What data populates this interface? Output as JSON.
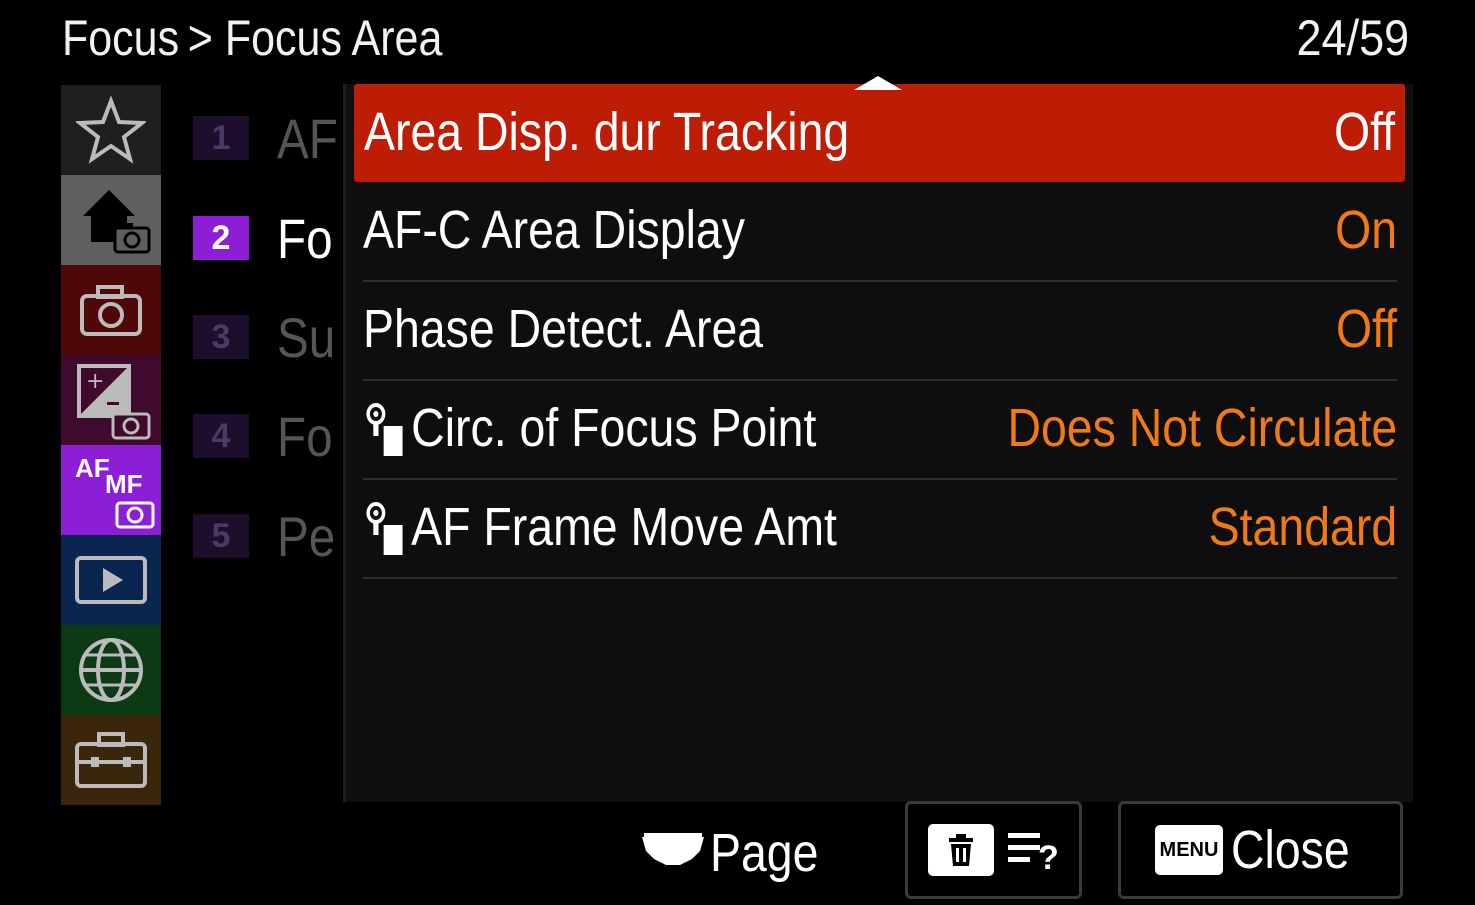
{
  "header": {
    "crumb_parent": "Focus",
    "crumb_separator": ">",
    "crumb_current": "Focus Area",
    "page_counter": "24/59"
  },
  "rail": {
    "items": [
      {
        "name": "my-menu",
        "icon": "star-icon",
        "color": "#1f1f1f"
      },
      {
        "name": "main-photo",
        "icon": "home-camera-icon",
        "color": "#5f5f5f"
      },
      {
        "name": "shooting",
        "icon": "camera-icon",
        "color": "#4f0808"
      },
      {
        "name": "exposure-color",
        "icon": "exposure-camera-icon",
        "color": "#3f0a2c"
      },
      {
        "name": "focus",
        "icon": "af-mf-icon",
        "label_af": "AF",
        "label_mf": "MF",
        "color": "#8e1dd6"
      },
      {
        "name": "playback",
        "icon": "play-icon",
        "color": "#0a2550"
      },
      {
        "name": "network",
        "icon": "globe-icon",
        "color": "#0b3a14"
      },
      {
        "name": "setup",
        "icon": "toolbox-icon",
        "color": "#3a260a"
      }
    ]
  },
  "pages": [
    {
      "num": "1",
      "label": "AF",
      "active": false
    },
    {
      "num": "2",
      "label": "Fo",
      "active": true
    },
    {
      "num": "3",
      "label": "Su",
      "active": false
    },
    {
      "num": "4",
      "label": "Fo",
      "active": false
    },
    {
      "num": "5",
      "label": "Pe",
      "active": false
    }
  ],
  "menu": {
    "items": [
      {
        "name": "Area Disp. dur Tracking",
        "value": "Off",
        "selected": true,
        "custom_icon": false
      },
      {
        "name": "AF-C Area Display",
        "value": "On",
        "selected": false,
        "custom_icon": false
      },
      {
        "name": "Phase Detect. Area",
        "value": "Off",
        "selected": false,
        "custom_icon": false
      },
      {
        "name": "Circ. of Focus Point",
        "value": "Does Not Circulate",
        "selected": false,
        "custom_icon": true
      },
      {
        "name": "AF Frame Move Amt",
        "value": "Standard",
        "selected": false,
        "custom_icon": true
      }
    ]
  },
  "footer": {
    "page_label": "Page",
    "menu_key": "MENU",
    "close_label": "Close",
    "help_icon": "help-list-icon",
    "delete_icon": "trash-icon"
  },
  "colors": {
    "selected_row": "#be1d05",
    "value_text": "#f07a14",
    "focus_accent": "#8e1dd6"
  }
}
